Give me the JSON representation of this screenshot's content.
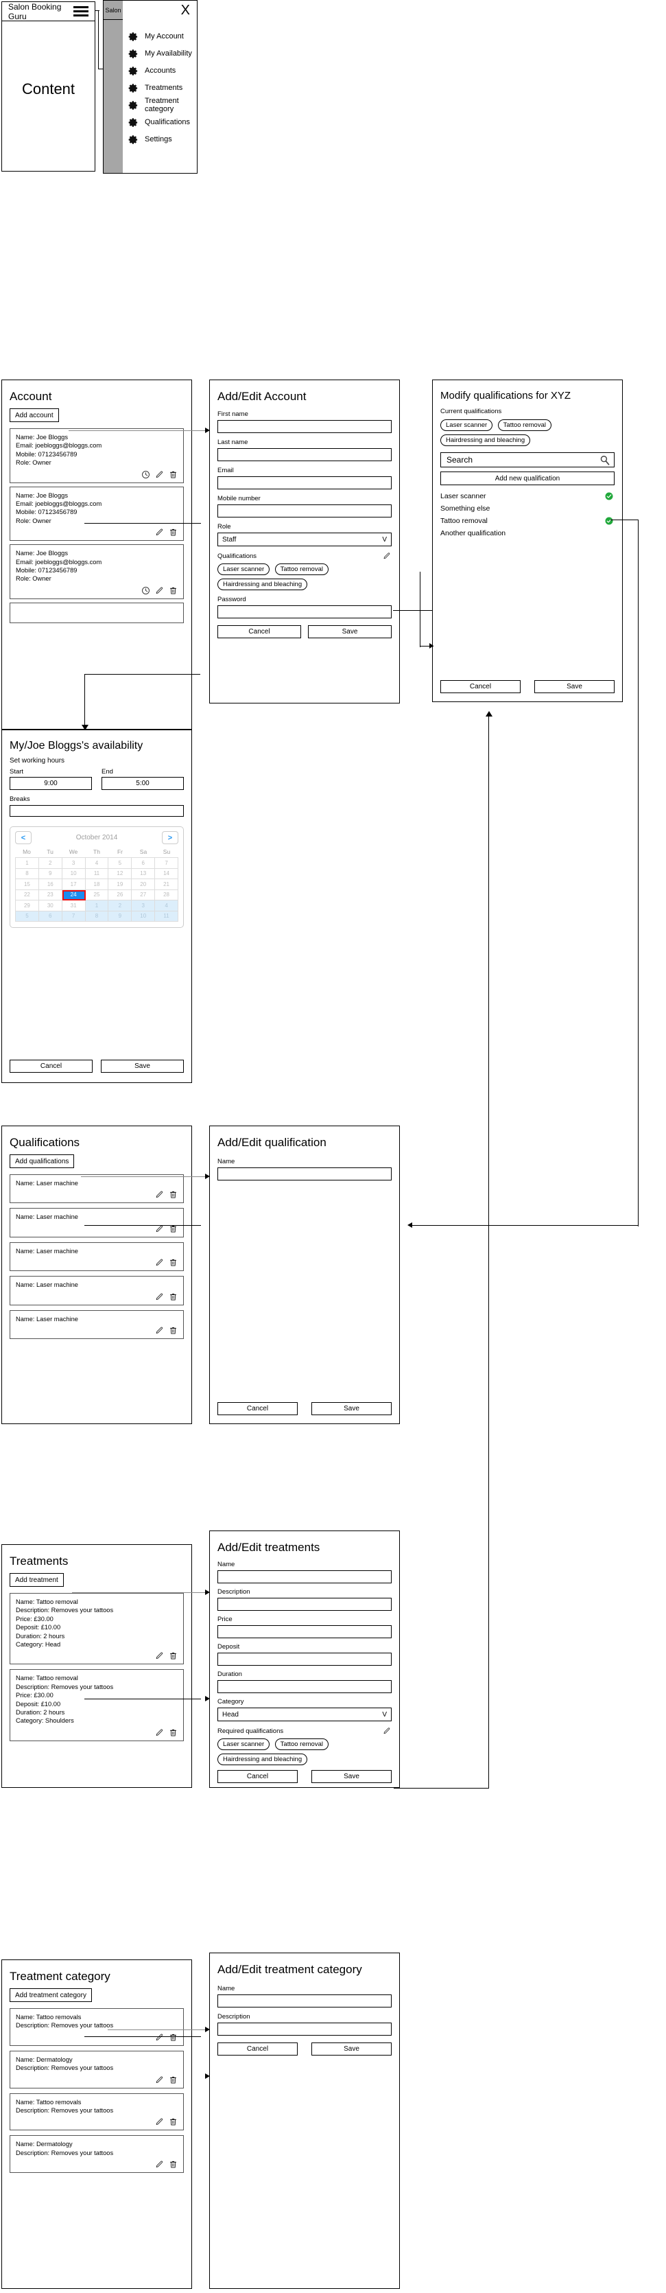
{
  "app": {
    "title": "Salon Booking Guru",
    "content_placeholder": "Content",
    "hamburger_icon": "hamburger-menu-icon",
    "close_icon": "X",
    "menu_tab_label": "Salon",
    "menu_items": [
      {
        "label": "My Account",
        "icon": "gear-icon"
      },
      {
        "label": "My Availability",
        "icon": "gear-icon"
      },
      {
        "label": "Accounts",
        "icon": "gear-icon"
      },
      {
        "label": "Treatments",
        "icon": "gear-icon"
      },
      {
        "label": "Treatment category",
        "icon": "gear-icon"
      },
      {
        "label": "Qualifications",
        "icon": "gear-icon"
      },
      {
        "label": "Settings",
        "icon": "gear-icon"
      }
    ]
  },
  "account_panel": {
    "title": "Account",
    "add_button": "Add account",
    "cards": [
      {
        "name": "Name: Joe Bloggs",
        "email": "Email: joebloggs@bloggs.com",
        "mobile": "Mobile: 07123456789",
        "role": "Role: Owner",
        "icons": [
          "clock-icon",
          "pencil-icon",
          "trash-icon"
        ]
      },
      {
        "name": "Name: Joe Bloggs",
        "email": "Email: joebloggs@bloggs.com",
        "mobile": "Mobile: 07123456789",
        "role": "Role: Owner",
        "icons": [
          "pencil-icon",
          "trash-icon"
        ]
      },
      {
        "name": "Name: Joe Bloggs",
        "email": "Email: joebloggs@bloggs.com",
        "mobile": "Mobile: 07123456789",
        "role": "Role: Owner",
        "icons": [
          "clock-icon",
          "pencil-icon",
          "trash-icon"
        ]
      }
    ]
  },
  "account_form": {
    "title": "Add/Edit Account",
    "first_name_label": "First name",
    "first_name_value": "",
    "last_name_label": "Last name",
    "last_name_value": "",
    "email_label": "Email",
    "email_value": "",
    "mobile_label": "Mobile number",
    "mobile_value": "",
    "role_label": "Role",
    "role_value": "Staff",
    "role_caret": "V",
    "qualifications_label": "Qualifications",
    "qualification_chips": [
      "Laser scanner",
      "Tattoo removal",
      "Hairdressing and bleaching"
    ],
    "password_label": "Password",
    "password_value": "",
    "cancel_label": "Cancel",
    "save_label": "Save"
  },
  "modify_qualifications": {
    "title": "Modify qualifications for XYZ",
    "current_label": "Current qualifications",
    "current_chips": [
      "Laser scanner",
      "Tattoo removal",
      "Hairdressing and bleaching"
    ],
    "search_placeholder": "Search",
    "search_icon": "magnifier-icon",
    "add_new_label": "Add new qualification",
    "rows": [
      {
        "label": "Laser scanner",
        "selected": true
      },
      {
        "label": "Something else",
        "selected": false
      },
      {
        "label": "Tattoo removal",
        "selected": true
      },
      {
        "label": "Another qualification",
        "selected": false
      }
    ],
    "tick_icon": "check-circle-icon",
    "tick_color": "#20a83a",
    "cancel_label": "Cancel",
    "save_label": "Save"
  },
  "availability": {
    "title": "My/Joe Bloggs's availability",
    "working_hours_label": "Set working hours",
    "start_label": "Start",
    "start_value": "9:00",
    "end_label": "End",
    "end_value": "5:00",
    "breaks_label": "Breaks",
    "breaks_value": "",
    "calendar": {
      "month": "October 2014",
      "prev_icon": "<",
      "next_icon": ">",
      "dow": [
        "Mo",
        "Tu",
        "We",
        "Th",
        "Fr",
        "Sa",
        "Su"
      ],
      "weeks": [
        [
          {
            "d": "1"
          },
          {
            "d": "2"
          },
          {
            "d": "3"
          },
          {
            "d": "4"
          },
          {
            "d": "5"
          },
          {
            "d": "6"
          },
          {
            "d": "7"
          }
        ],
        [
          {
            "d": "8"
          },
          {
            "d": "9"
          },
          {
            "d": "10"
          },
          {
            "d": "11"
          },
          {
            "d": "12"
          },
          {
            "d": "13"
          },
          {
            "d": "14"
          }
        ],
        [
          {
            "d": "15"
          },
          {
            "d": "16"
          },
          {
            "d": "17"
          },
          {
            "d": "18"
          },
          {
            "d": "19"
          },
          {
            "d": "20"
          },
          {
            "d": "21"
          }
        ],
        [
          {
            "d": "22"
          },
          {
            "d": "23"
          },
          {
            "d": "24",
            "sel": true
          },
          {
            "d": "25"
          },
          {
            "d": "26"
          },
          {
            "d": "27"
          },
          {
            "d": "28"
          }
        ],
        [
          {
            "d": "29"
          },
          {
            "d": "30"
          },
          {
            "d": "31"
          },
          {
            "d": "1",
            "out": true
          },
          {
            "d": "2",
            "out": true
          },
          {
            "d": "3",
            "out": true
          },
          {
            "d": "4",
            "out": true
          }
        ],
        [
          {
            "d": "5",
            "out": true
          },
          {
            "d": "6",
            "out": true
          },
          {
            "d": "7",
            "out": true
          },
          {
            "d": "8",
            "out": true
          },
          {
            "d": "9",
            "out": true
          },
          {
            "d": "10",
            "out": true
          },
          {
            "d": "11",
            "out": true
          }
        ]
      ],
      "selected_day": "24",
      "selected_color": "#1a8cf0",
      "selected_outline_color": "#ee1111"
    },
    "cancel_label": "Cancel",
    "save_label": "Save"
  },
  "qualifications_panel": {
    "title": "Qualifications",
    "add_button": "Add qualifications",
    "cards": [
      {
        "name": "Name: Laser machine",
        "icons": [
          "pencil-icon",
          "trash-icon"
        ]
      },
      {
        "name": "Name: Laser machine",
        "icons": [
          "pencil-icon",
          "trash-icon"
        ]
      },
      {
        "name": "Name: Laser machine",
        "icons": [
          "pencil-icon",
          "trash-icon"
        ]
      },
      {
        "name": "Name: Laser machine",
        "icons": [
          "pencil-icon",
          "trash-icon"
        ]
      },
      {
        "name": "Name: Laser machine",
        "icons": [
          "pencil-icon",
          "trash-icon"
        ]
      }
    ]
  },
  "qualification_form": {
    "title": "Add/Edit qualification",
    "name_label": "Name",
    "name_value": "",
    "cancel_label": "Cancel",
    "save_label": "Save"
  },
  "treatments_panel": {
    "title": "Treatments",
    "add_button": "Add treatment",
    "cards": [
      {
        "lines": [
          "Name: Tattoo removal",
          "Description: Removes your tattoos",
          "Price: £30.00",
          "Deposit: £10.00",
          "Duration: 2 hours",
          "Category: Head"
        ],
        "icons": [
          "pencil-icon",
          "trash-icon"
        ]
      },
      {
        "lines": [
          "Name: Tattoo removal",
          "Description: Removes your tattoos",
          "Price: £30.00",
          "Deposit: £10.00",
          "Duration: 2 hours",
          "Category: Shoulders"
        ],
        "icons": [
          "pencil-icon",
          "trash-icon"
        ]
      }
    ]
  },
  "treatments_form": {
    "title": "Add/Edit treatments",
    "name_label": "Name",
    "name_value": "",
    "description_label": "Description",
    "description_value": "",
    "price_label": "Price",
    "price_value": "",
    "deposit_label": "Deposit",
    "deposit_value": "",
    "duration_label": "Duration",
    "duration_value": "",
    "category_label": "Category",
    "category_value": "Head",
    "category_caret": "V",
    "required_qualifications_label": "Required qualifications",
    "qualification_chips": [
      "Laser scanner",
      "Tattoo removal",
      "Hairdressing and bleaching"
    ],
    "cancel_label": "Cancel",
    "save_label": "Save"
  },
  "treatment_category_panel": {
    "title": "Treatment category",
    "add_button": "Add treatment category",
    "cards": [
      {
        "name": "Name: Tattoo removals",
        "description": "Description: Removes your tattoos",
        "icons": [
          "pencil-icon",
          "trash-icon"
        ]
      },
      {
        "name": "Name: Dermatology",
        "description": "Description: Removes your tattoos",
        "icons": [
          "pencil-icon",
          "trash-icon"
        ]
      },
      {
        "name": "Name: Tattoo removals",
        "description": "Description: Removes your tattoos",
        "icons": [
          "pencil-icon",
          "trash-icon"
        ]
      },
      {
        "name": "Name: Dermatology",
        "description": "Description: Removes your tattoos",
        "icons": [
          "pencil-icon",
          "trash-icon"
        ]
      }
    ]
  },
  "treatment_category_form": {
    "title": "Add/Edit treatment category",
    "name_label": "Name",
    "name_value": "",
    "description_label": "Description",
    "description_value": "",
    "cancel_label": "Cancel",
    "save_label": "Save"
  }
}
